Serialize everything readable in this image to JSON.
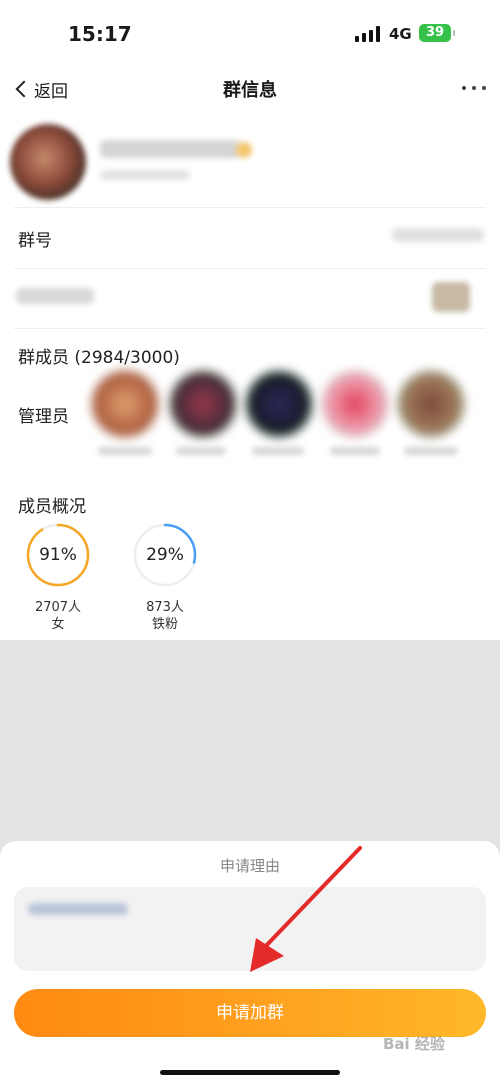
{
  "status_bar": {
    "time": "15:17",
    "network": "4G",
    "battery": "39"
  },
  "nav": {
    "back_label": "返回",
    "title": "群信息"
  },
  "rows": {
    "group_id_label": "群号",
    "members_label": "群成员 (2984/3000)",
    "admins_label": "管理员",
    "overview_label": "成员概况"
  },
  "overview": [
    {
      "percent": "91%",
      "percent_value": 0.91,
      "count": "2707人",
      "name": "女",
      "color": "#f5a623"
    },
    {
      "percent": "29%",
      "percent_value": 0.29,
      "count": "873人",
      "name": "铁粉",
      "color": "#4a9ef5"
    }
  ],
  "sheet": {
    "title": "申请理由",
    "submit_label": "申请加群"
  },
  "watermark": "Bai 经验",
  "colors": {
    "accent": "#ff9418",
    "background": "#e3e3e3"
  }
}
